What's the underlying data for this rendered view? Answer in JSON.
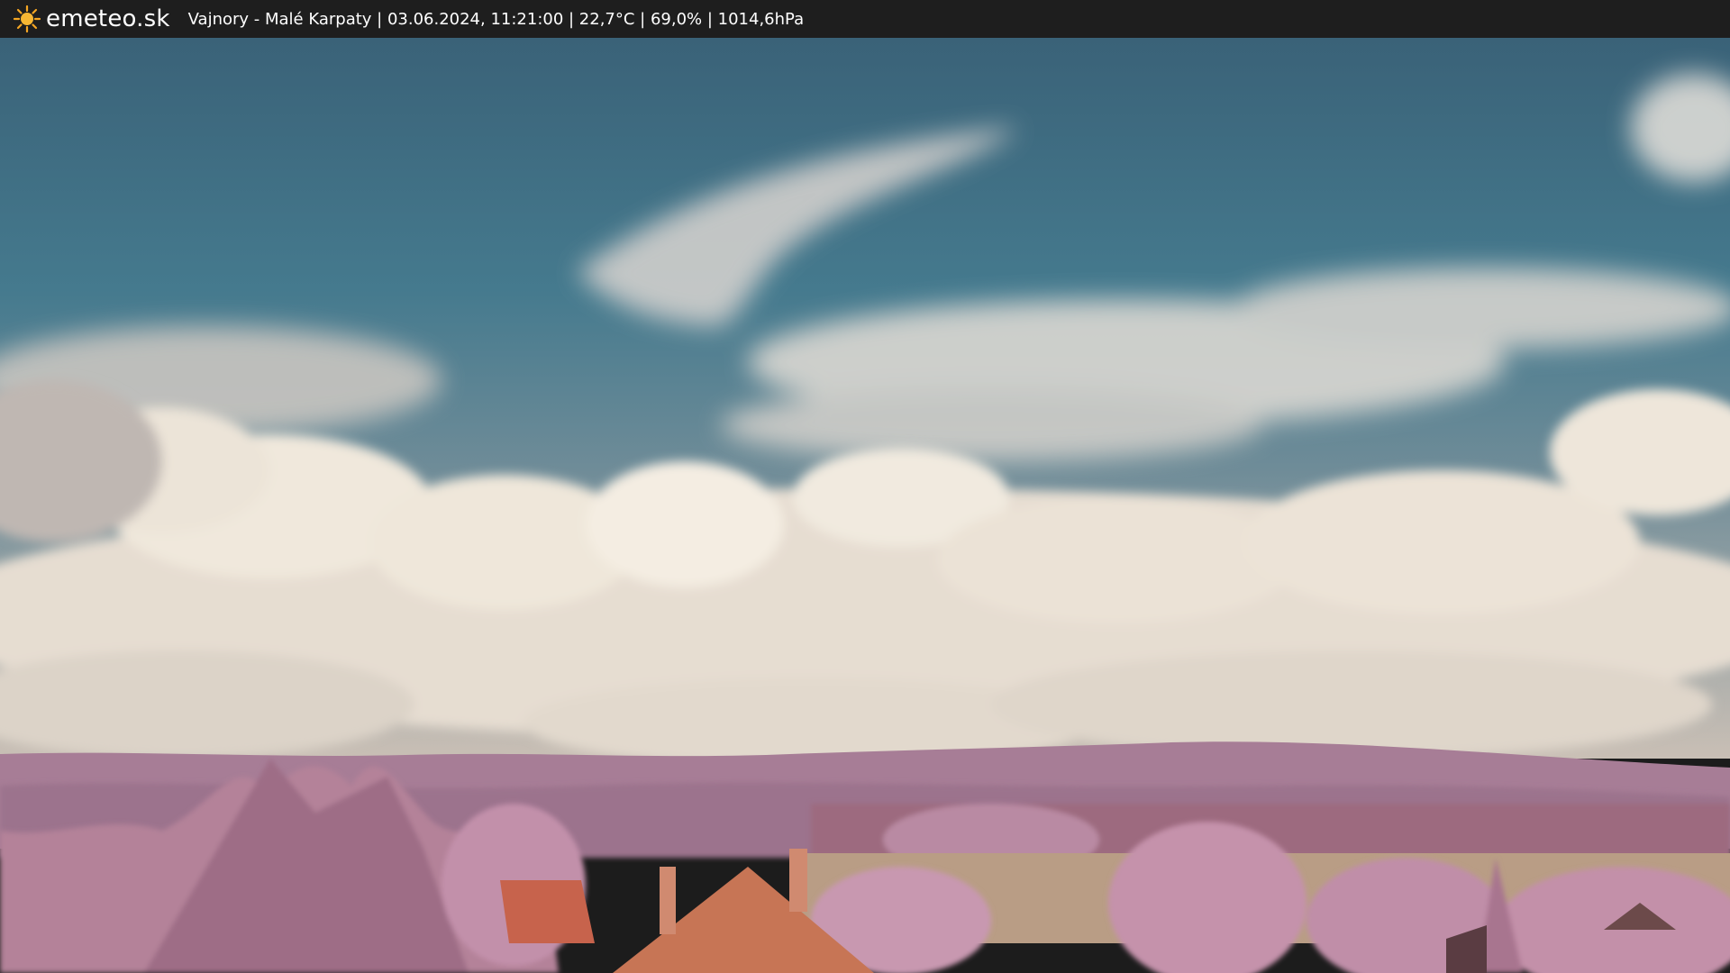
{
  "brand": {
    "name": "emeteo.sk",
    "icon": "sun-icon",
    "icon_color": "#f5a623"
  },
  "caption": {
    "text": "Vajnory - Malé Karpaty | 03.06.2024, 11:21:00 | 22,7°C | 69,0% | 1014,6hPa"
  },
  "scene": {
    "description_colors": {
      "sky": "#3f7288",
      "clouds": "#f2ebdf",
      "hills": "#a87d98",
      "foliage": "#c08aa8",
      "roofs": "#c2624a"
    }
  }
}
